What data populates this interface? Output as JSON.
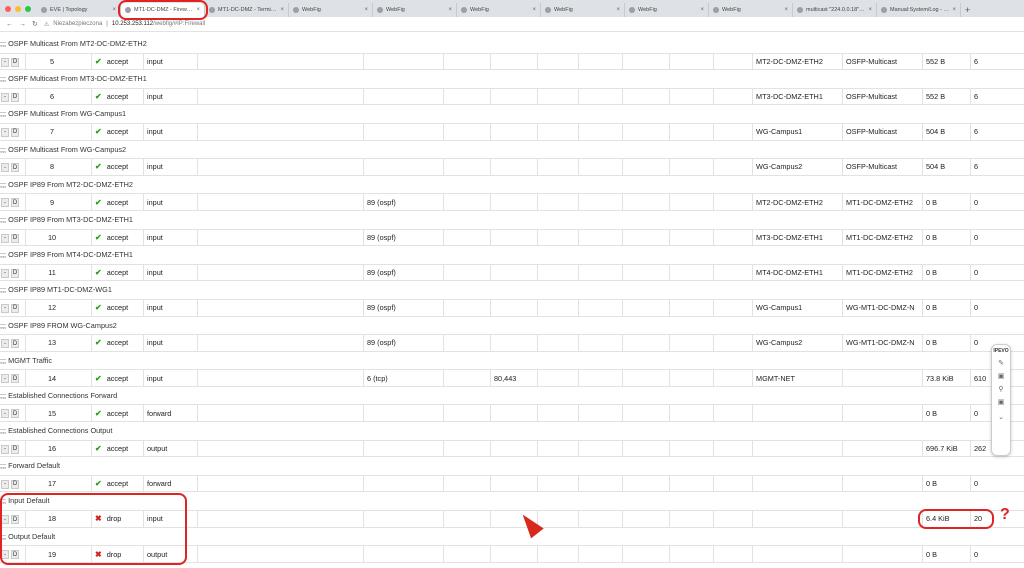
{
  "browser": {
    "tabs": [
      {
        "label": "EVE | Topology",
        "active": false
      },
      {
        "label": "MT1-DC-DMZ - Firewall a",
        "active": true
      },
      {
        "label": "MT1-DC-DMZ - Terminal",
        "active": false
      },
      {
        "label": "WebFig",
        "active": false
      },
      {
        "label": "WebFig",
        "active": false
      },
      {
        "label": "WebFig",
        "active": false
      },
      {
        "label": "WebFig",
        "active": false
      },
      {
        "label": "WebFig",
        "active": false
      },
      {
        "label": "WebFig",
        "active": false
      },
      {
        "label": "multicast \"224.0.0.18\" mi",
        "active": false
      },
      {
        "label": "Manual:System/Log - Mik",
        "active": false
      }
    ],
    "url_warning": "Niezabezpieczona",
    "url_host": "10.253.253.112",
    "url_path": "/webfig/#IP:Firewall"
  },
  "colors": {
    "accent_red": "#e02424",
    "accept_green": "#2d9b1f",
    "drop_red": "#cc2222"
  },
  "toolbar": {
    "brand": "IPEVO",
    "icons": [
      "pen-icon",
      "image-icon",
      "search-doc-icon",
      "camera-icon",
      "chevron-down-icon"
    ]
  },
  "rules": [
    {
      "comment": ";;; OSPF Multicast From MT2-DC-DMZ-ETH2",
      "num": "5",
      "action": "accept",
      "chain": "input",
      "protocol": "",
      "port": "",
      "in_interface": "MT2-DC-DMZ-ETH2",
      "address_list": "OSFP-Multicast",
      "bytes": "552 B",
      "packets": "6"
    },
    {
      "comment": ";;; OSPF Multicast From MT3-DC-DMZ-ETH1",
      "num": "6",
      "action": "accept",
      "chain": "input",
      "protocol": "",
      "port": "",
      "in_interface": "MT3-DC-DMZ-ETH1",
      "address_list": "OSFP-Multicast",
      "bytes": "552 B",
      "packets": "6"
    },
    {
      "comment": ";;; OSPF Multicast From WG-Campus1",
      "num": "7",
      "action": "accept",
      "chain": "input",
      "protocol": "",
      "port": "",
      "in_interface": "WG-Campus1",
      "address_list": "OSFP-Multicast",
      "bytes": "504 B",
      "packets": "6"
    },
    {
      "comment": ";;; OSPF Multicast From WG-Campus2",
      "num": "8",
      "action": "accept",
      "chain": "input",
      "protocol": "",
      "port": "",
      "in_interface": "WG-Campus2",
      "address_list": "OSFP-Multicast",
      "bytes": "504 B",
      "packets": "6"
    },
    {
      "comment": ";;; OSPF IP89 From MT2-DC-DMZ-ETH2",
      "num": "9",
      "action": "accept",
      "chain": "input",
      "protocol": "89 (ospf)",
      "port": "",
      "in_interface": "MT2-DC-DMZ-ETH2",
      "address_list": "MT1-DC-DMZ-ETH2",
      "bytes": "0 B",
      "packets": "0"
    },
    {
      "comment": ";;; OSPF IP89 From MT3-DC-DMZ-ETH1",
      "num": "10",
      "action": "accept",
      "chain": "input",
      "protocol": "89 (ospf)",
      "port": "",
      "in_interface": "MT3-DC-DMZ-ETH1",
      "address_list": "MT1-DC-DMZ-ETH2",
      "bytes": "0 B",
      "packets": "0"
    },
    {
      "comment": ";;; OSPF IP89 From MT4-DC-DMZ-ETH1",
      "num": "11",
      "action": "accept",
      "chain": "input",
      "protocol": "89 (ospf)",
      "port": "",
      "in_interface": "MT4-DC-DMZ-ETH1",
      "address_list": "MT1-DC-DMZ-ETH2",
      "bytes": "0 B",
      "packets": "0"
    },
    {
      "comment": ";;; OSPF IP89 MT1-DC-DMZ-WG1",
      "num": "12",
      "action": "accept",
      "chain": "input",
      "protocol": "89 (ospf)",
      "port": "",
      "in_interface": "WG-Campus1",
      "address_list": "WG-MT1-DC-DMZ-N",
      "bytes": "0 B",
      "packets": "0"
    },
    {
      "comment": ";;; OSPF IP89 FROM WG-Campus2",
      "num": "13",
      "action": "accept",
      "chain": "input",
      "protocol": "89 (ospf)",
      "port": "",
      "in_interface": "WG-Campus2",
      "address_list": "WG-MT1-DC-DMZ-N",
      "bytes": "0 B",
      "packets": "0"
    },
    {
      "comment": ";;; MGMT Traffic",
      "num": "14",
      "action": "accept",
      "chain": "input",
      "protocol": "6 (tcp)",
      "port": "80,443",
      "in_interface": "MGMT-NET",
      "address_list": "",
      "bytes": "73.8 KiB",
      "packets": "610"
    },
    {
      "comment": ";;; Established Connections Forward",
      "num": "15",
      "action": "accept",
      "chain": "forward",
      "protocol": "",
      "port": "",
      "in_interface": "",
      "address_list": "",
      "bytes": "0 B",
      "packets": "0"
    },
    {
      "comment": ";;; Established Connections Output",
      "num": "16",
      "action": "accept",
      "chain": "output",
      "protocol": "",
      "port": "",
      "in_interface": "",
      "address_list": "",
      "bytes": "696.7 KiB",
      "packets": "262"
    },
    {
      "comment": ";;; Forward Default",
      "num": "17",
      "action": "accept",
      "chain": "forward",
      "protocol": "",
      "port": "",
      "in_interface": "",
      "address_list": "",
      "bytes": "0 B",
      "packets": "0"
    },
    {
      "comment": ";;; Input Default",
      "num": "18",
      "action": "drop",
      "chain": "input",
      "protocol": "",
      "port": "",
      "in_interface": "",
      "address_list": "",
      "bytes": "6.4 KiB",
      "packets": "20"
    },
    {
      "comment": ";;; Output Default",
      "num": "19",
      "action": "drop",
      "chain": "output",
      "protocol": "",
      "port": "",
      "in_interface": "",
      "address_list": "",
      "bytes": "0 B",
      "packets": "0"
    }
  ],
  "row_buttons": {
    "remove": "-",
    "disable": "D"
  },
  "top_comment": ";;; OSPF Multicast From MT2-DC-DMZ-ETH2",
  "annotation": {
    "question_mark": "?"
  }
}
